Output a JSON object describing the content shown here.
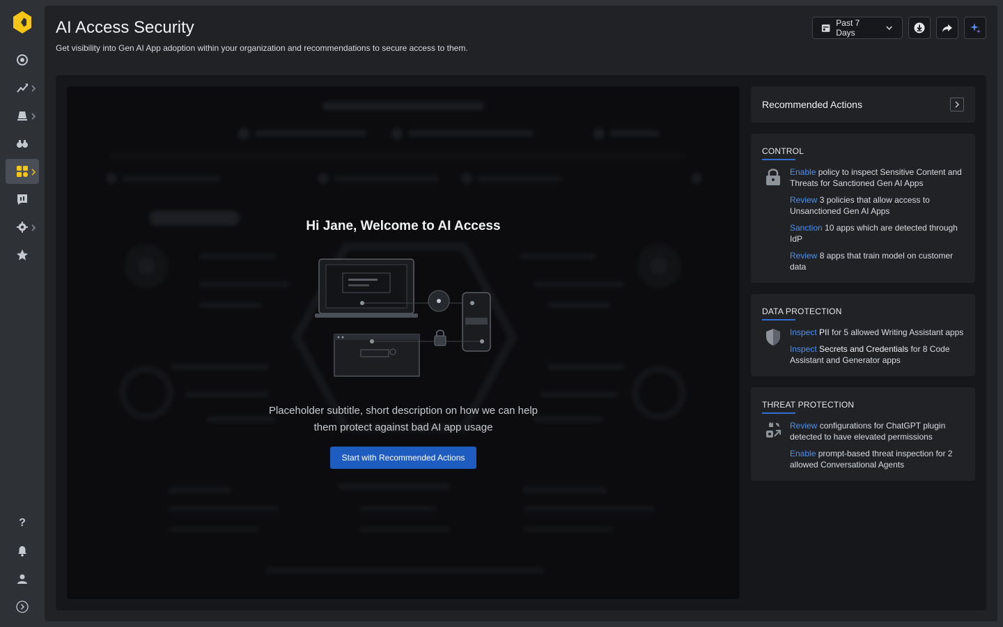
{
  "page": {
    "title": "AI Access Security",
    "subtitle": "Get visibility into Gen AI App adoption within your organization and recommendations to secure access to them."
  },
  "toolbar": {
    "date_range": "Past 7 Days"
  },
  "nav": {
    "items": [
      {
        "icon": "target-icon"
      },
      {
        "icon": "analytics-icon"
      },
      {
        "icon": "alert-bell-icon"
      },
      {
        "icon": "binoculars-icon"
      },
      {
        "icon": "apps-icon",
        "active": true
      },
      {
        "icon": "report-icon"
      },
      {
        "icon": "settings-icon"
      },
      {
        "icon": "star-icon"
      }
    ],
    "bottom": [
      {
        "icon": "help-icon",
        "label": "?"
      },
      {
        "icon": "notifications-icon"
      },
      {
        "icon": "user-icon"
      },
      {
        "icon": "expand-icon"
      }
    ]
  },
  "welcome": {
    "title": "Hi Jane, Welcome to AI Access",
    "subtitle": "Placeholder subtitle, short description on how we can help them protect against bad AI app usage",
    "cta": "Start with Recommended Actions"
  },
  "recommended": {
    "title": "Recommended Actions"
  },
  "cards": {
    "control": {
      "title": "CONTROL",
      "icon": "lock-icon",
      "actions": [
        {
          "link": "Enable",
          "text": " policy to inspect Sensitive Content and Threats for Sanctioned Gen AI Apps"
        },
        {
          "link": "Review",
          "text": " 3 policies that allow access to Unsanctioned Gen AI Apps"
        },
        {
          "link": "Sanction",
          "text": " 10 apps which are detected through IdP"
        },
        {
          "link": "Review",
          "text": " 8 apps that train model on customer data"
        }
      ]
    },
    "data_protection": {
      "title": "DATA PROTECTION",
      "icon": "shield-icon",
      "actions": [
        {
          "link": "Inspect",
          "bold": "PII",
          "text": " for 5 allowed Writing Assistant apps"
        },
        {
          "link": "Inspect",
          "bold": "Secrets and Credentials",
          "text": " for 8 Code Assistant and Generator apps"
        }
      ]
    },
    "threat_protection": {
      "title": "THREAT PROTECTION",
      "icon": "threat-icon",
      "actions": [
        {
          "link": "Review",
          "text": " configurations for ChatGPT plugin detected to have elevated permissions"
        },
        {
          "link": "Enable",
          "text": " prompt-based threat inspection for 2 allowed Conversational Agents"
        }
      ]
    }
  }
}
